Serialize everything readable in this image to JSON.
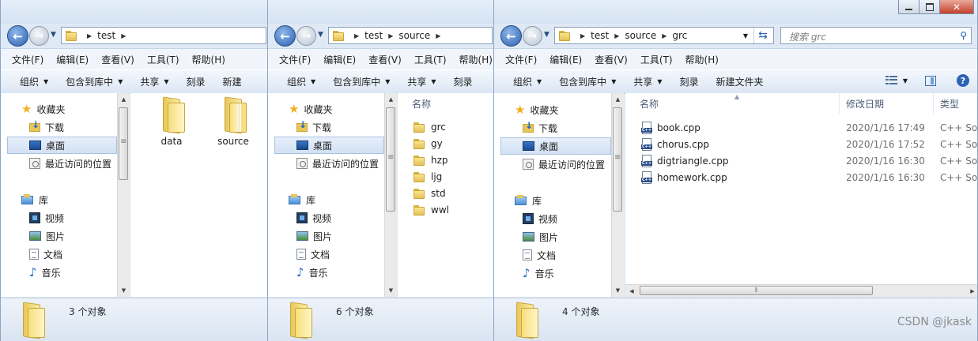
{
  "menu": [
    "文件(F)",
    "编辑(E)",
    "查看(V)",
    "工具(T)",
    "帮助(H)"
  ],
  "nav": {
    "favorites": "收藏夹",
    "downloads": "下载",
    "desktop": "桌面",
    "recent": "最近访问的位置",
    "libraries": "库",
    "videos": "视频",
    "pictures": "图片",
    "documents": "文档",
    "music": "音乐"
  },
  "toolbar": {
    "organize": "组织",
    "include_library": "包含到库中",
    "share": "共享",
    "burn": "刻录",
    "new_folder_cut": "新建",
    "new_folder": "新建文件夹"
  },
  "window1": {
    "breadcrumb": [
      "test"
    ],
    "items": [
      "data",
      "source"
    ],
    "status": "3 个对象"
  },
  "window2": {
    "breadcrumb": [
      "test",
      "source"
    ],
    "column_name": "名称",
    "items": [
      "grc",
      "gy",
      "hzp",
      "ljg",
      "std",
      "wwl"
    ],
    "status": "6 个对象"
  },
  "window3": {
    "breadcrumb": [
      "test",
      "source",
      "grc"
    ],
    "search_placeholder": "搜索 grc",
    "columns": {
      "name": "名称",
      "modified": "修改日期",
      "type": "类型"
    },
    "files": [
      {
        "name": "book.cpp",
        "modified": "2020/1/16 17:49",
        "type": "C++ So"
      },
      {
        "name": "chorus.cpp",
        "modified": "2020/1/16 17:52",
        "type": "C++ So"
      },
      {
        "name": "digtriangle.cpp",
        "modified": "2020/1/16 16:30",
        "type": "C++ So"
      },
      {
        "name": "homework.cpp",
        "modified": "2020/1/16 16:30",
        "type": "C++ So"
      }
    ],
    "status": "4 个对象"
  },
  "watermark": "CSDN @jkask",
  "colors": {
    "accent": "#2a5fae",
    "chrome": "#dfe9f5",
    "selection": "#d2e1f4"
  }
}
